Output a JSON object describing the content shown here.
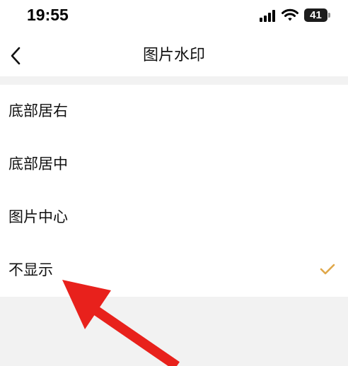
{
  "status_bar": {
    "time": "19:55",
    "battery_level": "41",
    "icons": [
      "signal-icon",
      "wifi-icon",
      "battery-icon"
    ]
  },
  "nav": {
    "title": "图片水印",
    "back_icon": "chevron-left-icon"
  },
  "options": [
    {
      "label": "底部居右",
      "selected": false
    },
    {
      "label": "底部居中",
      "selected": false
    },
    {
      "label": "图片中心",
      "selected": false
    },
    {
      "label": "不显示",
      "selected": true
    }
  ],
  "colors": {
    "accent_check": "#e0a84a",
    "annotation_arrow": "#e8211c",
    "background": "#f2f2f2"
  }
}
